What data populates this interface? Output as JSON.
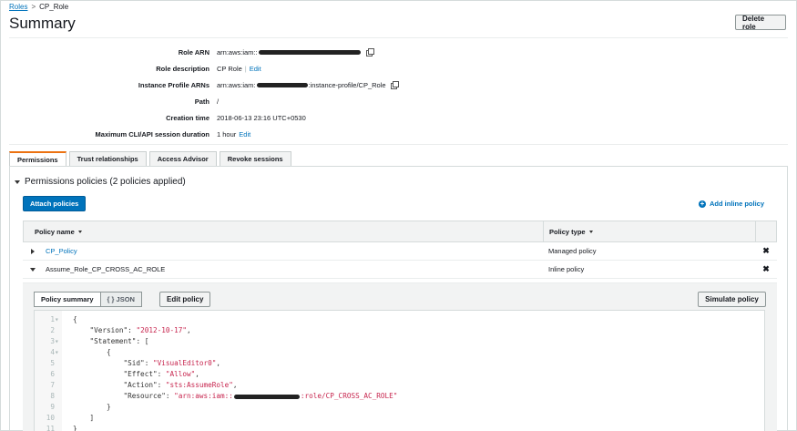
{
  "breadcrumb": {
    "roles": "Roles",
    "separator": ">",
    "current": "CP_Role"
  },
  "header": {
    "title": "Summary",
    "delete_button": "Delete role"
  },
  "summary": {
    "role_arn_label": "Role ARN",
    "role_arn_prefix": "arn:aws:iam::",
    "role_description_label": "Role description",
    "role_description_value": "CP Role",
    "role_description_edit": "Edit",
    "instance_profile_label": "Instance Profile ARNs",
    "instance_profile_prefix": "arn:aws:iam:",
    "instance_profile_suffix": ":instance-profile/CP_Role",
    "path_label": "Path",
    "path_value": "/",
    "creation_time_label": "Creation time",
    "creation_time_value": "2018-06-13 23:16 UTC+0530",
    "max_session_label": "Maximum CLI/API session duration",
    "max_session_value": "1 hour",
    "max_session_edit": "Edit"
  },
  "tabs": [
    "Permissions",
    "Trust relationships",
    "Access Advisor",
    "Revoke sessions"
  ],
  "permissions": {
    "section_title": "Permissions policies (2 policies applied)",
    "attach_button": "Attach policies",
    "add_inline": "Add inline policy",
    "columns": {
      "name": "Policy name",
      "type": "Policy type"
    },
    "rows": [
      {
        "name": "CP_Policy",
        "type": "Managed policy",
        "remove": "✖"
      },
      {
        "name": "Assume_Role_CP_CROSS_AC_ROLE",
        "type": "Inline policy",
        "remove": "✖"
      }
    ]
  },
  "detail": {
    "policy_summary": "Policy summary",
    "json": "{ } JSON",
    "edit_policy": "Edit policy",
    "simulate_policy": "Simulate policy"
  },
  "json_editor": {
    "lines": [
      {
        "n": "1",
        "fold": "▾",
        "indent": "",
        "key": "",
        "sep": "",
        "val": "",
        "tail": "{"
      },
      {
        "n": "2",
        "fold": "",
        "indent": "    ",
        "key": "\"Version\"",
        "sep": ": ",
        "val": "\"2012-10-17\"",
        "tail": ","
      },
      {
        "n": "3",
        "fold": "▾",
        "indent": "    ",
        "key": "\"Statement\"",
        "sep": ": ",
        "val": "",
        "tail": "["
      },
      {
        "n": "4",
        "fold": "▾",
        "indent": "        ",
        "key": "",
        "sep": "",
        "val": "",
        "tail": "{"
      },
      {
        "n": "5",
        "fold": "",
        "indent": "            ",
        "key": "\"Sid\"",
        "sep": ": ",
        "val": "\"VisualEditor0\"",
        "tail": ","
      },
      {
        "n": "6",
        "fold": "",
        "indent": "            ",
        "key": "\"Effect\"",
        "sep": ": ",
        "val": "\"Allow\"",
        "tail": ","
      },
      {
        "n": "7",
        "fold": "",
        "indent": "            ",
        "key": "\"Action\"",
        "sep": ": ",
        "val": "\"sts:AssumeRole\"",
        "tail": ","
      },
      {
        "n": "8",
        "fold": "",
        "indent": "            ",
        "key": "\"Resource\"",
        "sep": ": ",
        "val": "\"arn:aws:iam::",
        "tail": ""
      },
      {
        "n": "9",
        "fold": "",
        "indent": "        ",
        "key": "",
        "sep": "",
        "val": "",
        "tail": "}"
      },
      {
        "n": "10",
        "fold": "",
        "indent": "    ",
        "key": "",
        "sep": "",
        "val": "",
        "tail": "]"
      },
      {
        "n": "11",
        "fold": "",
        "indent": "",
        "key": "",
        "sep": "",
        "val": "",
        "tail": "}"
      }
    ],
    "resource_suffix": ":role/CP_CROSS_AC_ROLE\""
  },
  "icons": {
    "copy": "copy-icon",
    "plus": "plus-circle-icon",
    "remove": "close-icon"
  },
  "colors": {
    "accent": "#0073bb",
    "active_tab": "#ec7211",
    "json_string": "#c7254e"
  }
}
